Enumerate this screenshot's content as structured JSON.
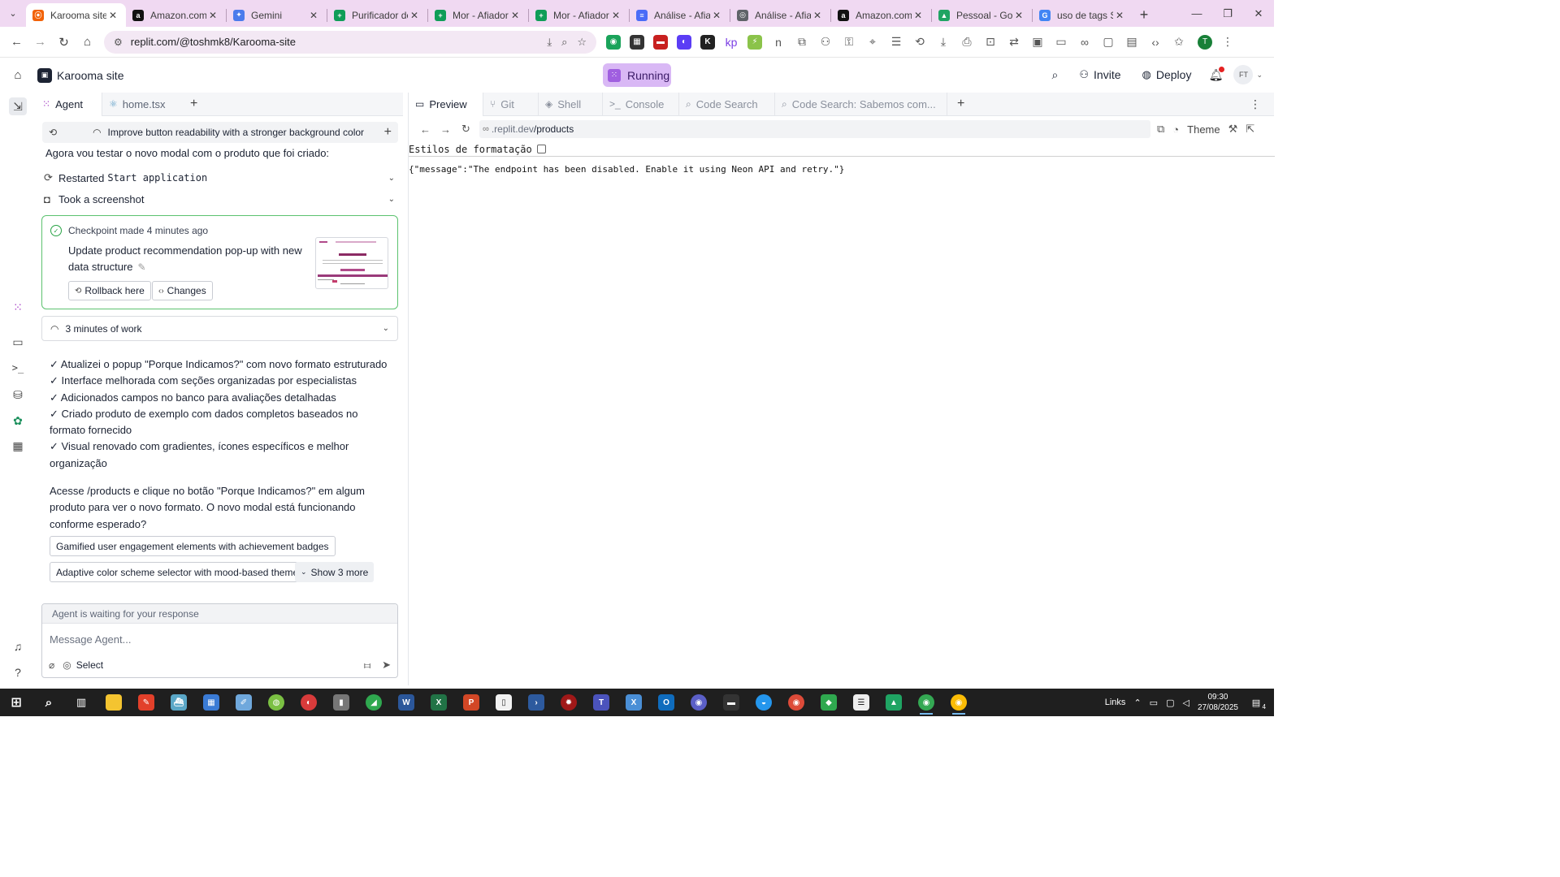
{
  "browser": {
    "tabs": [
      {
        "label": "Karooma site -",
        "favicon_color": "#f26207",
        "favicon_glyph": "⦿",
        "active": true
      },
      {
        "label": "Amazon.com.S",
        "favicon_color": "#111111",
        "favicon_glyph": "a"
      },
      {
        "label": "Gemini",
        "favicon_color": "#4b7bec",
        "favicon_glyph": "✦"
      },
      {
        "label": "Purificador de",
        "favicon_color": "#0f9d58",
        "favicon_glyph": "+"
      },
      {
        "label": "Mor - Afiador",
        "favicon_color": "#0f9d58",
        "favicon_glyph": "+"
      },
      {
        "label": "Mor - Afiador",
        "favicon_color": "#0f9d58",
        "favicon_glyph": "+"
      },
      {
        "label": "Análise - Afiad",
        "favicon_color": "#4a6cf7",
        "favicon_glyph": "≡"
      },
      {
        "label": "Análise - Afiad",
        "favicon_color": "#5f6368",
        "favicon_glyph": "◎"
      },
      {
        "label": "Amazon.com.b",
        "favicon_color": "#111111",
        "favicon_glyph": "a"
      },
      {
        "label": "Pessoal - Goog",
        "favicon_color": "#1fa463",
        "favicon_glyph": "▲"
      },
      {
        "label": "uso de tags SE",
        "favicon_color": "#4285f4",
        "favicon_glyph": "G"
      }
    ],
    "url": "replit.com/@toshmk8/Karooma-site"
  },
  "header": {
    "repl_name": "Karooma site",
    "run_status": "Running",
    "invite_label": "Invite",
    "deploy_label": "Deploy",
    "avatar_initials": "FT",
    "accent": "#d9b8f5"
  },
  "agent_panel": {
    "tabs": [
      {
        "label": "Agent"
      },
      {
        "label": "home.tsx"
      }
    ],
    "thread_title": "Improve button readability with a stronger background color",
    "intro": "Agora vou testar o novo modal com o produto que foi criado:",
    "actions": [
      {
        "prefix": "Restarted",
        "code": "Start application"
      },
      {
        "prefix": "Took a screenshot",
        "code": ""
      }
    ],
    "checkpoint": {
      "meta": "Checkpoint made 4 minutes ago",
      "description": "Update product recommendation pop-up with new data structure",
      "rollback_label": "Rollback here",
      "changes_label": "Changes"
    },
    "work_summary": "3 minutes of work",
    "checklist": [
      "✓ Atualizei o popup \"Porque Indicamos?\" com novo formato estruturado",
      "✓ Interface melhorada com seções organizadas por especialistas",
      "✓ Adicionados campos no banco para avaliações detalhadas",
      "✓ Criado produto de exemplo com dados completos baseados no formato fornecido",
      "✓ Visual renovado com gradientes, ícones específicos e melhor organização"
    ],
    "final_message": "Acesse /products e clique no botão \"Porque Indicamos?\" em algum produto para ver o novo formato. O novo modal está funcionando conforme esperado?",
    "suggestions": [
      "Gamified user engagement elements with achievement badges",
      "Adaptive color scheme selector with mood-based themes"
    ],
    "show_more_label": "Show 3 more",
    "composer": {
      "status": "Agent is waiting for your response",
      "placeholder": "Message Agent...",
      "select_label": "Select"
    }
  },
  "preview": {
    "tabs": [
      {
        "label": "Preview"
      },
      {
        "label": "Git"
      },
      {
        "label": "Shell"
      },
      {
        "label": "Console"
      },
      {
        "label": "Code Search"
      },
      {
        "label": "Code Search: Sabemos com..."
      }
    ],
    "url_domain": ".replit.dev",
    "url_path": "/products",
    "theme_label": "Theme",
    "format_label": "Estilos de formatação",
    "response_body": "{\"message\":\"The endpoint has been disabled. Enable it using Neon API and retry.\"}"
  },
  "taskbar": {
    "tray_label": "Links",
    "time": "09:30",
    "date": "27/08/2025",
    "notification_count": "4"
  }
}
